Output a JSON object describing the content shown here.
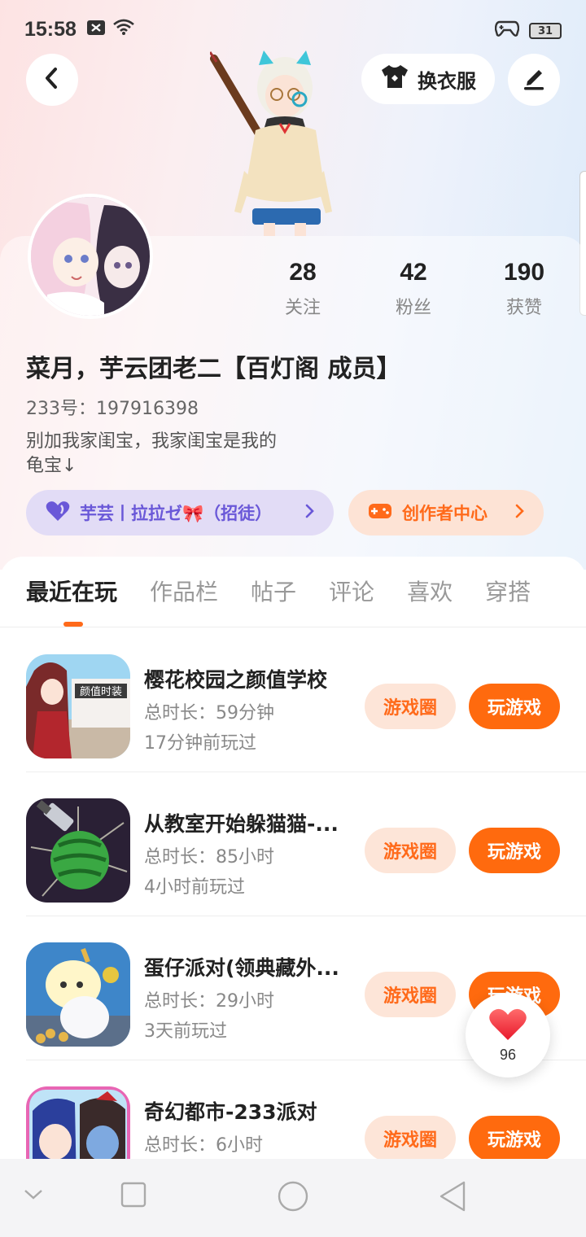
{
  "status_bar": {
    "time": "15:58",
    "battery": "31"
  },
  "header": {
    "dress_button": "换衣服"
  },
  "profile": {
    "stats": [
      {
        "value": "28",
        "label": "关注"
      },
      {
        "value": "42",
        "label": "粉丝"
      },
      {
        "value": "190",
        "label": "获赞"
      }
    ],
    "username": "菜月，芋云团老二【百灯阁 成员】",
    "uid": "233号：197916398",
    "bio_line1": "别加我家闺宝，我家闺宝是我的",
    "bio_line2": "龟宝↓",
    "group_pill": "芋芸丨拉拉ゼ🎀（招徒）",
    "creator_pill": "创作者中心"
  },
  "tabs": [
    "最近在玩",
    "作品栏",
    "帖子",
    "评论",
    "喜欢",
    "穿搭"
  ],
  "games": [
    {
      "title": "樱花校园之颜值学校",
      "duration": "总时长：59分钟",
      "last_played": "17分钟前玩过",
      "icon": "sakura-school-icon",
      "icon_text": "颜值时装"
    },
    {
      "title": "从教室开始躲猫猫-...",
      "duration": "总时长：85小时",
      "last_played": "4小时前玩过",
      "icon": "watermelon-knife-icon"
    },
    {
      "title": "蛋仔派对(领典藏外...",
      "duration": "总时长：29小时",
      "last_played": "3天前玩过",
      "icon": "eggy-party-icon"
    },
    {
      "title": "奇幻都市-233派对",
      "duration": "总时长：6小时",
      "last_played": "",
      "icon": "fantasy-city-icon"
    }
  ],
  "game_buttons": {
    "circle": "游戏圈",
    "play": "玩游戏"
  },
  "like_float": {
    "count": "96"
  },
  "colors": {
    "accent": "#ff6a0e",
    "purple": "#6a58d8"
  }
}
